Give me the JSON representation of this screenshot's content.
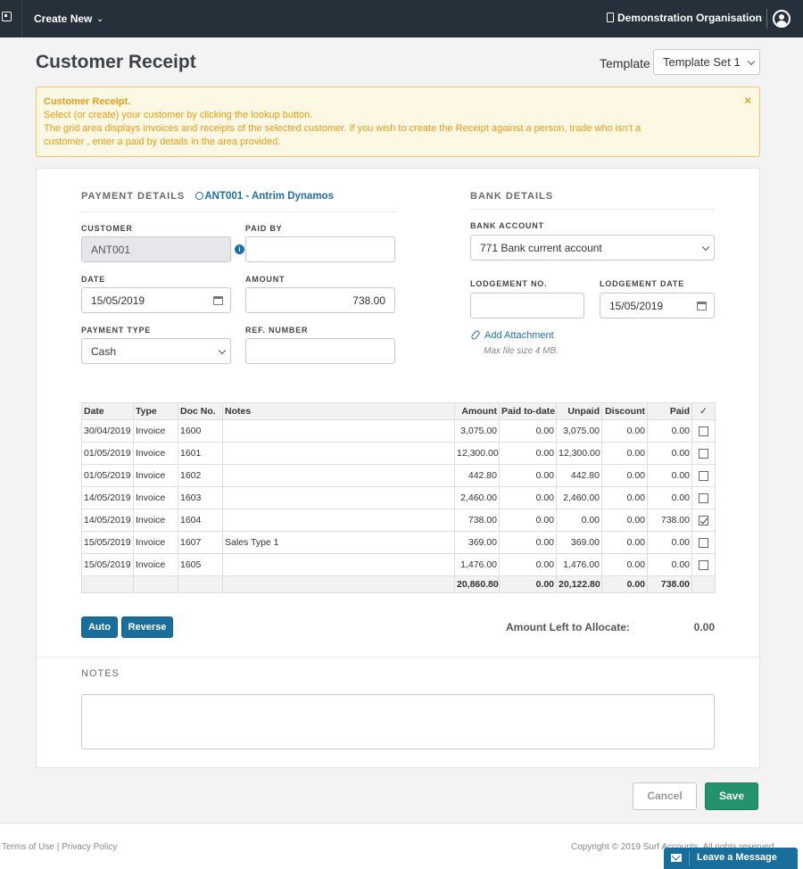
{
  "topbar": {
    "create_new": "Create New",
    "organisation": "Demonstration Organisation"
  },
  "page": {
    "title": "Customer Receipt",
    "template_label": "Template",
    "template_value": "Template Set 1"
  },
  "alert": {
    "title": "Customer Receipt.",
    "line1": "Select (or create) your customer by clicking the lookup button.",
    "line2": "The grid area displays invoices and receipts of the selected customer. If you wish to create the Receipt against a person, trade who isn't a",
    "line3": "customer , enter a paid by details in the area provided.",
    "close": "×"
  },
  "payment": {
    "heading": "PAYMENT DETAILS",
    "customer_link": "ANT001 - Antrim Dynamos",
    "customer_label": "CUSTOMER",
    "customer_value": "ANT001",
    "paid_by_label": "PAID BY",
    "paid_by_value": "",
    "date_label": "DATE",
    "date_value": "15/05/2019",
    "amount_label": "AMOUNT",
    "amount_value": "738.00",
    "payment_type_label": "PAYMENT TYPE",
    "payment_type_value": "Cash",
    "ref_label": "REF. NUMBER",
    "ref_value": ""
  },
  "bank": {
    "heading": "BANK DETAILS",
    "account_label": "BANK ACCOUNT",
    "account_value": "771 Bank current account",
    "lodgement_no_label": "LODGEMENT NO.",
    "lodgement_no_value": "",
    "lodgement_date_label": "LODGEMENT DATE",
    "lodgement_date_value": "15/05/2019",
    "add_attachment": "Add Attachment",
    "max_size": "Max file size 4 MB."
  },
  "grid": {
    "headers": [
      "Date",
      "Type",
      "Doc No.",
      "Notes",
      "Amount",
      "Paid to-date",
      "Unpaid",
      "Discount",
      "Paid",
      "✓"
    ],
    "rows": [
      {
        "date": "30/04/2019",
        "type": "Invoice",
        "doc": "1600",
        "notes": "",
        "amount": "3,075.00",
        "paid_to_date": "0.00",
        "unpaid": "3,075.00",
        "discount": "0.00",
        "paid": "0.00",
        "checked": false
      },
      {
        "date": "01/05/2019",
        "type": "Invoice",
        "doc": "1601",
        "notes": "",
        "amount": "12,300.00",
        "paid_to_date": "0.00",
        "unpaid": "12,300.00",
        "discount": "0.00",
        "paid": "0.00",
        "checked": false
      },
      {
        "date": "01/05/2019",
        "type": "Invoice",
        "doc": "1602",
        "notes": "",
        "amount": "442.80",
        "paid_to_date": "0.00",
        "unpaid": "442.80",
        "discount": "0.00",
        "paid": "0.00",
        "checked": false
      },
      {
        "date": "14/05/2019",
        "type": "Invoice",
        "doc": "1603",
        "notes": "",
        "amount": "2,460.00",
        "paid_to_date": "0.00",
        "unpaid": "2,460.00",
        "discount": "0.00",
        "paid": "0.00",
        "checked": false
      },
      {
        "date": "14/05/2019",
        "type": "Invoice",
        "doc": "1604",
        "notes": "",
        "amount": "738.00",
        "paid_to_date": "0.00",
        "unpaid": "0.00",
        "discount": "0.00",
        "paid": "738.00",
        "checked": true
      },
      {
        "date": "15/05/2019",
        "type": "Invoice",
        "doc": "1607",
        "notes": "Sales Type 1",
        "amount": "369.00",
        "paid_to_date": "0.00",
        "unpaid": "369.00",
        "discount": "0.00",
        "paid": "0.00",
        "checked": false
      },
      {
        "date": "15/05/2019",
        "type": "Invoice",
        "doc": "1605",
        "notes": "",
        "amount": "1,476.00",
        "paid_to_date": "0.00",
        "unpaid": "1,476.00",
        "discount": "0.00",
        "paid": "0.00",
        "checked": false
      }
    ],
    "totals": {
      "amount": "20,860.80",
      "paid_to_date": "0.00",
      "unpaid": "20,122.80",
      "discount": "0.00",
      "paid": "738.00"
    }
  },
  "actions": {
    "auto": "Auto",
    "reverse": "Reverse",
    "amount_left_label": "Amount Left to Allocate:",
    "amount_left_value": "0.00"
  },
  "notes": {
    "label": "NOTES",
    "value": ""
  },
  "buttons": {
    "cancel": "Cancel",
    "save": "Save"
  },
  "footer": {
    "terms": "Terms of Use",
    "separator": "|",
    "privacy": "Privacy Policy",
    "copyright": "Copyright © 2019 Surf Accounts. All rights reserved."
  },
  "chat": {
    "label": "Leave a Message"
  }
}
